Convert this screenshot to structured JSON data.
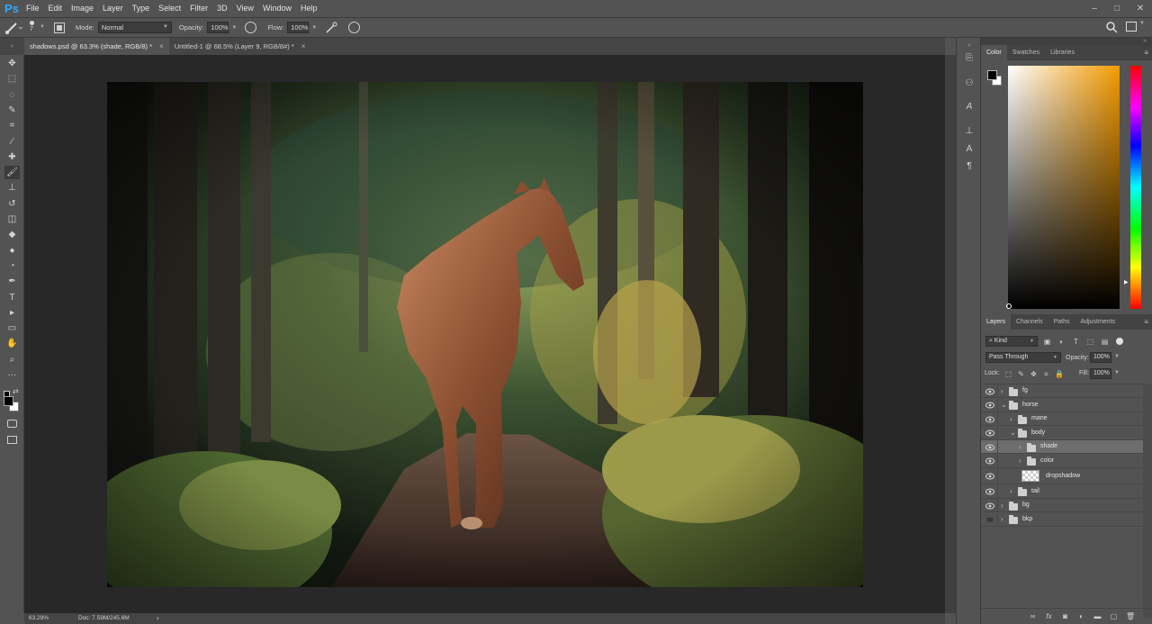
{
  "app": {
    "logo": "Ps"
  },
  "menu": [
    "File",
    "Edit",
    "Image",
    "Layer",
    "Type",
    "Select",
    "Filter",
    "3D",
    "View",
    "Window",
    "Help"
  ],
  "window_controls": {
    "minimize": "–",
    "maximize": "□",
    "close": "✕"
  },
  "options_bar": {
    "brush_size": "7",
    "mode_label": "Mode:",
    "mode_value": "Normal",
    "opacity_label": "Opacity:",
    "opacity_value": "100%",
    "flow_label": "Flow:",
    "flow_value": "100%"
  },
  "document_tabs": [
    {
      "label": "shadows.psd @ 63.3% (shade, RGB/8) *",
      "active": true
    },
    {
      "label": "Untitled-1 @ 68.5% (Layer 9, RGB/8#) *",
      "active": false
    }
  ],
  "tab_close": "×",
  "status_bar": {
    "zoom": "63.29%",
    "doc_info": "Doc: 7.59M/245.6M",
    "arrow": "›"
  },
  "tools": [
    {
      "name": "move-tool-icon",
      "glyph": "✥"
    },
    {
      "name": "marquee-tool-icon",
      "glyph": "⬚"
    },
    {
      "name": "lasso-tool-icon",
      "glyph": "◌"
    },
    {
      "name": "quick-select-tool-icon",
      "glyph": "✎"
    },
    {
      "name": "crop-tool-icon",
      "glyph": "⌗"
    },
    {
      "name": "eyedropper-tool-icon",
      "glyph": "⁄"
    },
    {
      "name": "healing-brush-tool-icon",
      "glyph": "✚"
    },
    {
      "name": "brush-tool-icon",
      "glyph": "🖌"
    },
    {
      "name": "clone-stamp-tool-icon",
      "glyph": "⊥"
    },
    {
      "name": "history-brush-tool-icon",
      "glyph": "↺"
    },
    {
      "name": "eraser-tool-icon",
      "glyph": "◫"
    },
    {
      "name": "paint-bucket-tool-icon",
      "glyph": "◆"
    },
    {
      "name": "blur-tool-icon",
      "glyph": "●"
    },
    {
      "name": "dodge-tool-icon",
      "glyph": "◔"
    },
    {
      "name": "pen-tool-icon",
      "glyph": "✒"
    },
    {
      "name": "type-tool-icon",
      "glyph": "T"
    },
    {
      "name": "path-select-tool-icon",
      "glyph": "▸"
    },
    {
      "name": "shape-tool-icon",
      "glyph": "▭"
    },
    {
      "name": "hand-tool-icon",
      "glyph": "✋"
    },
    {
      "name": "zoom-tool-icon",
      "glyph": "⌕"
    },
    {
      "name": "more-tools-icon",
      "glyph": "···"
    }
  ],
  "color_panel": {
    "tabs": [
      "Color",
      "Swatches",
      "Libraries"
    ],
    "foreground": "#000000",
    "background": "#ffffff",
    "hue_color": "#f49b00"
  },
  "layers_panel": {
    "tabs": [
      "Layers",
      "Channels",
      "Paths",
      "Adjustments"
    ],
    "filter_label": "Kind",
    "blend_mode": "Pass Through",
    "opacity_label": "Opacity:",
    "opacity_value": "100%",
    "lock_label": "Lock:",
    "fill_label": "Fill:",
    "fill_value": "100%",
    "layers": [
      {
        "name": "fg",
        "indent": 0,
        "type": "group",
        "expanded": false,
        "visible": true,
        "selected": false
      },
      {
        "name": "horse",
        "indent": 0,
        "type": "group",
        "expanded": true,
        "visible": true,
        "selected": false
      },
      {
        "name": "mane",
        "indent": 1,
        "type": "group",
        "expanded": false,
        "visible": true,
        "selected": false
      },
      {
        "name": "body",
        "indent": 1,
        "type": "group",
        "expanded": true,
        "visible": true,
        "selected": false
      },
      {
        "name": "shade",
        "indent": 2,
        "type": "group",
        "expanded": false,
        "visible": true,
        "selected": true
      },
      {
        "name": "color",
        "indent": 2,
        "type": "group",
        "expanded": false,
        "visible": true,
        "selected": false
      },
      {
        "name": "dropshadow",
        "indent": 2,
        "type": "pixel",
        "expanded": false,
        "visible": true,
        "selected": false
      },
      {
        "name": "tail",
        "indent": 1,
        "type": "group",
        "expanded": false,
        "visible": true,
        "selected": false
      },
      {
        "name": "bg",
        "indent": 0,
        "type": "group",
        "expanded": false,
        "visible": true,
        "selected": false
      },
      {
        "name": "bkp",
        "indent": 0,
        "type": "group",
        "expanded": false,
        "visible": false,
        "selected": false
      }
    ]
  }
}
